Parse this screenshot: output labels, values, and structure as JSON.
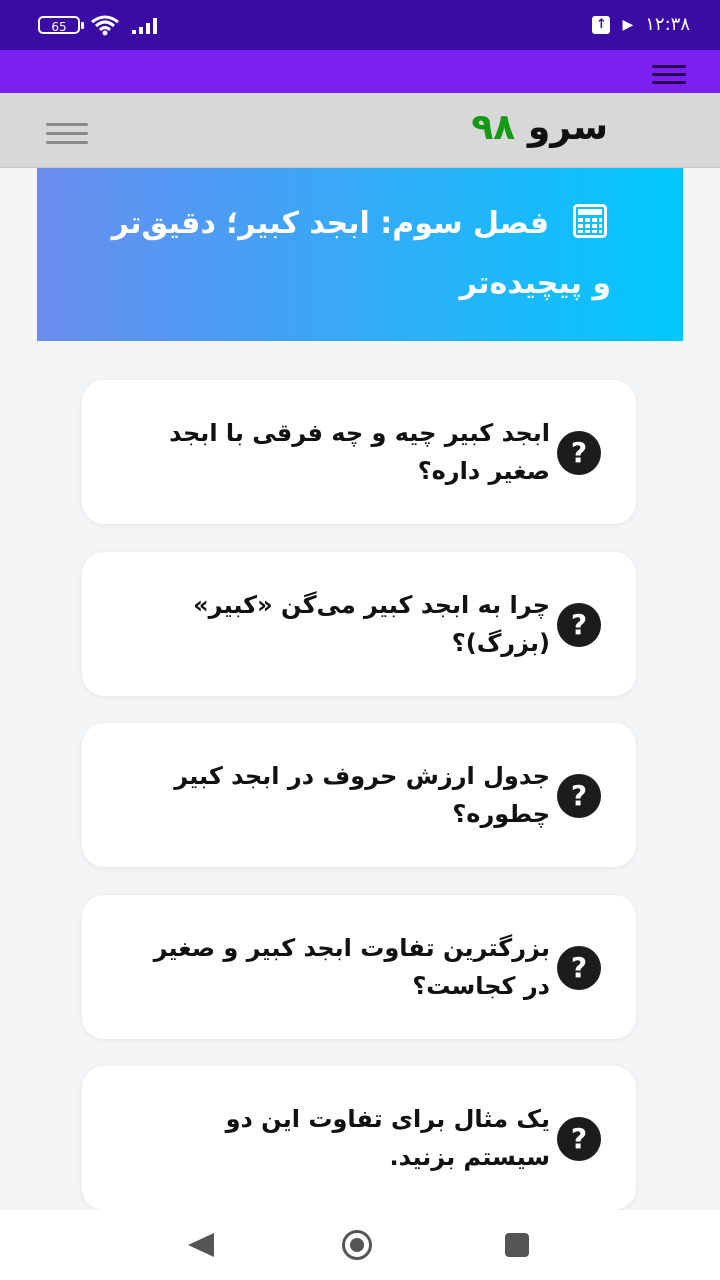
{
  "status_bar": {
    "battery": "65",
    "time": "۱۲:۳۸"
  },
  "header": {
    "brand_word": "سرو",
    "brand_number": "۹۸"
  },
  "chapter": {
    "title": "فصل سوم: ابجد کبیر؛ دقیق‌تر و پیچیده‌تر",
    "icon": "calculator-icon"
  },
  "questions": [
    {
      "text": "ابجد کبیر چیه و چه فرقی با ابجد صغیر داره؟"
    },
    {
      "text": "چرا به ابجد کبیر می‌گن «کبیر» (بزرگ)؟"
    },
    {
      "text": "جدول ارزش حروف در ابجد کبیر چطوره؟"
    },
    {
      "text": "بزرگترین تفاوت ابجد کبیر و صغیر در کجاست؟"
    },
    {
      "text": "یک مثال برای تفاوت این دو سیستم بزنید."
    }
  ],
  "colors": {
    "status_bar": "#3a0ca3",
    "purple_bar": "#7b1ff2",
    "brand_green": "#169a16",
    "banner_start": "#6b8cf0",
    "banner_end": "#00c8ff"
  }
}
